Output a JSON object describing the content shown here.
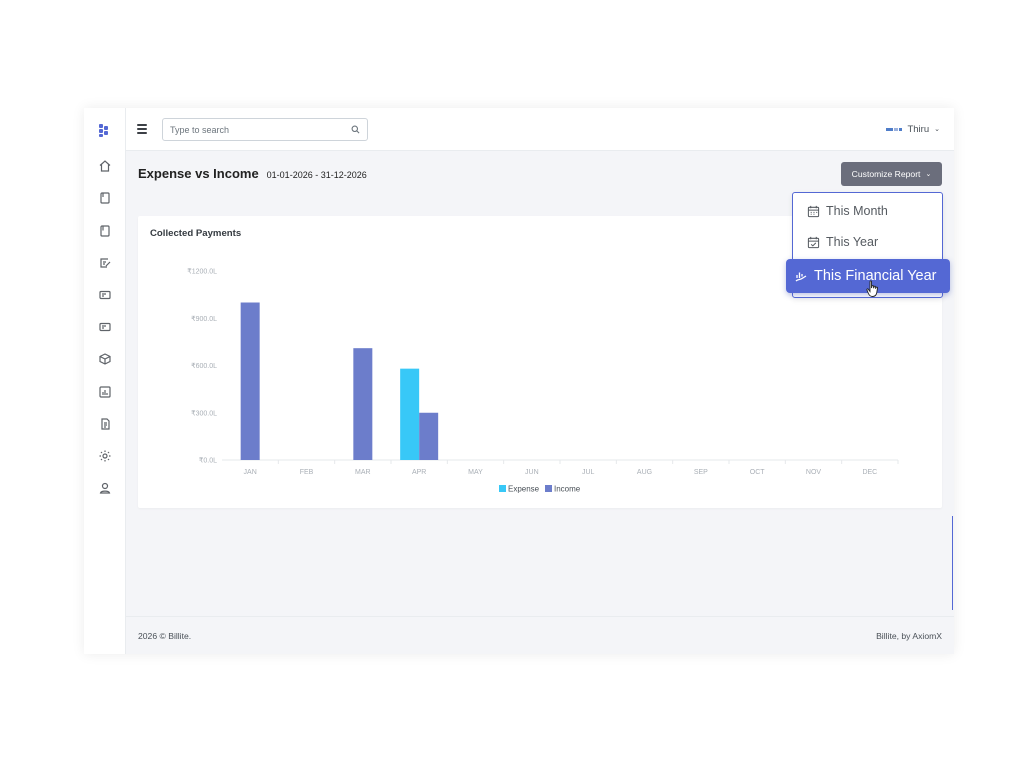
{
  "topbar": {
    "search_placeholder": "Type to search",
    "user_name": "Thiru"
  },
  "sidebar": {
    "icons": [
      "home-icon",
      "book-icon",
      "bookmark-icon",
      "edit-note-icon",
      "card-icon",
      "card-alt-icon",
      "box-icon",
      "chart-icon",
      "document-icon",
      "gear-icon",
      "user-icon"
    ]
  },
  "page": {
    "title": "Expense vs Income",
    "date_range": "01-01-2026 - 31-12-2026",
    "customize_button": "Customize Report"
  },
  "dropdown": {
    "items": [
      {
        "label": "This Month",
        "icon": "calendar-icon"
      },
      {
        "label": "This Year",
        "icon": "calendar-check-icon"
      },
      {
        "label": "This Financial Year",
        "icon": "chart-hand-icon",
        "active": true
      }
    ]
  },
  "card": {
    "title": "Collected Payments"
  },
  "chart_data": {
    "type": "bar",
    "categories": [
      "JAN",
      "FEB",
      "MAR",
      "APR",
      "MAY",
      "JUN",
      "JUL",
      "AUG",
      "SEP",
      "OCT",
      "NOV",
      "DEC"
    ],
    "series": [
      {
        "name": "Expense",
        "color": "#38c8f7",
        "values": [
          0,
          0,
          0,
          580,
          0,
          0,
          0,
          0,
          0,
          0,
          0,
          0
        ]
      },
      {
        "name": "Income",
        "color": "#6c7dcb",
        "values": [
          1000,
          0,
          710,
          300,
          0,
          0,
          0,
          0,
          0,
          0,
          0,
          0
        ]
      }
    ],
    "y_ticks": [
      "₹0.0L",
      "₹300.0L",
      "₹600.0L",
      "₹900.0L",
      "₹1200.0L"
    ],
    "ylim": [
      0,
      1200
    ],
    "legend_position": "bottom"
  },
  "footer": {
    "left": "2026 © Billite.",
    "right": "Billite, by AxiomX"
  }
}
